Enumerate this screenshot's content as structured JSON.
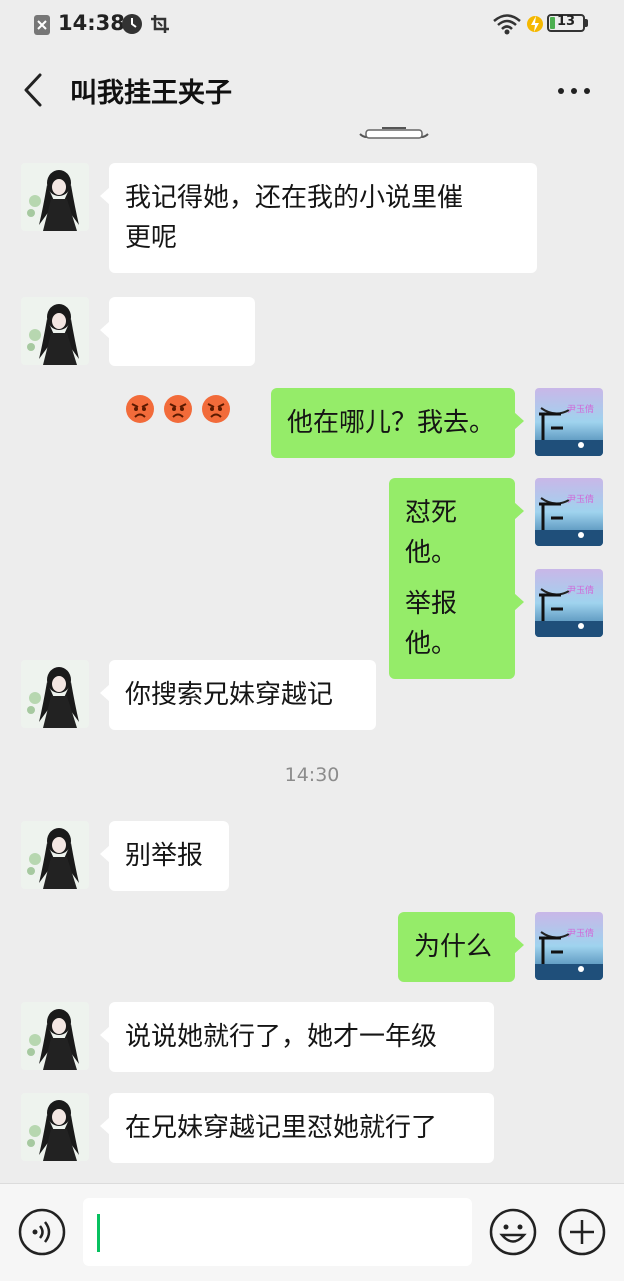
{
  "status_bar": {
    "time": "14:38",
    "battery": "13",
    "icons": [
      "notification-blocked-icon",
      "clock-badge-icon",
      "screenshot-icon",
      "wifi-icon",
      "charging-icon",
      "battery-icon"
    ]
  },
  "header": {
    "title": "叫我挂王夹子",
    "back_icon": "chevron-left-icon",
    "more_icon": "more-dots-icon"
  },
  "messages": [
    {
      "side": "in",
      "text": "我记得她，还在我的小说里催\n更呢"
    },
    {
      "side": "in",
      "emojis": [
        "angry-face-emoji",
        "angry-face-emoji",
        "angry-face-emoji"
      ]
    },
    {
      "side": "out",
      "text": "他在哪儿？我去。"
    },
    {
      "side": "out",
      "text": "怼死他。"
    },
    {
      "side": "out",
      "text": "举报他。"
    },
    {
      "side": "in",
      "text": "你搜索兄妹穿越记"
    },
    {
      "side": "in",
      "text": "别举报"
    },
    {
      "side": "out",
      "text": "为什么"
    },
    {
      "side": "in",
      "text": "说说她就行了，她才一年级"
    },
    {
      "side": "in",
      "text": "在兄妹穿越记里怼她就行了"
    }
  ],
  "timestamp": "14:30",
  "input_bar": {
    "voice_icon": "voice-icon",
    "emoji_icon": "smiley-icon",
    "plus_icon": "plus-circle-icon",
    "input_value": ""
  },
  "colors": {
    "background": "#ededed",
    "outgoing_bubble": "#95ec69",
    "incoming_bubble": "#ffffff",
    "caret": "#07c160"
  }
}
